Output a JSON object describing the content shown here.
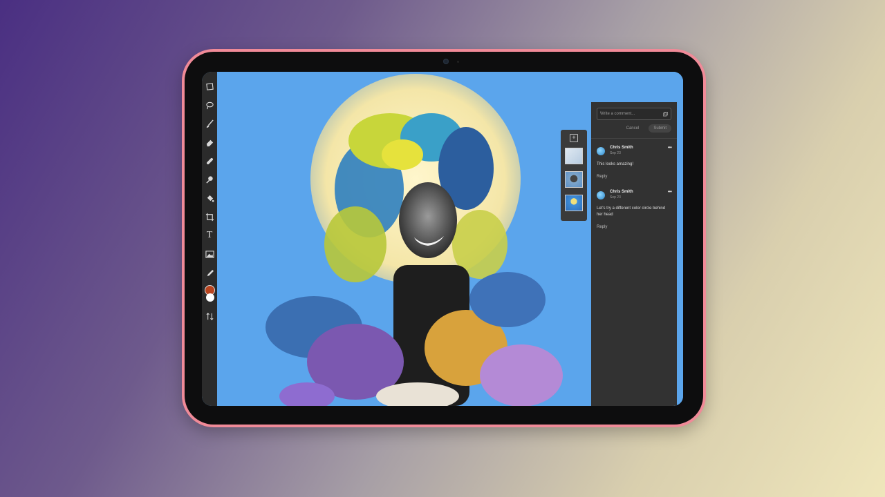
{
  "tools": [
    {
      "name": "transform-tool",
      "icon": "transform-icon"
    },
    {
      "name": "lasso-tool",
      "icon": "lasso-icon"
    },
    {
      "name": "brush-tool",
      "icon": "brush-icon"
    },
    {
      "name": "eraser-tool",
      "icon": "eraser-icon"
    },
    {
      "name": "healing-tool",
      "icon": "bandage-icon"
    },
    {
      "name": "clone-tool",
      "icon": "stamp-icon"
    },
    {
      "name": "fill-tool",
      "icon": "paint-bucket-icon"
    },
    {
      "name": "crop-tool",
      "icon": "crop-icon"
    },
    {
      "name": "type-tool",
      "icon": "type-icon",
      "glyph": "T"
    },
    {
      "name": "place-image-tool",
      "icon": "image-icon"
    },
    {
      "name": "eyedropper-tool",
      "icon": "eyedropper-icon"
    }
  ],
  "colors": {
    "foreground": "#b8441f",
    "background": "#ffffff",
    "canvas_bg": "#5ba5ec"
  },
  "comments_panel": {
    "input_placeholder": "Write a comment...",
    "cancel_label": "Cancel",
    "submit_label": "Submit",
    "comments": [
      {
        "author": "Chris Smith",
        "date": "Sep 23",
        "text": "This looks amazing!",
        "reply_label": "Reply"
      },
      {
        "author": "Chris Smith",
        "date": "Sep 23",
        "text": "Let's try a different color circle behind her head",
        "reply_label": "Reply"
      }
    ]
  }
}
